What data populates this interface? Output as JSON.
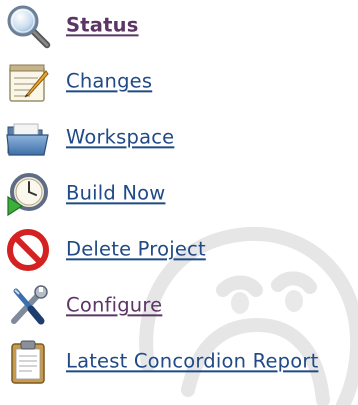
{
  "sidebar": {
    "tasks": [
      {
        "label": "Status",
        "icon": "search-icon",
        "state": "current"
      },
      {
        "label": "Changes",
        "icon": "notepad-icon",
        "state": "link"
      },
      {
        "label": "Workspace",
        "icon": "folder-icon",
        "state": "link"
      },
      {
        "label": "Build Now",
        "icon": "clock-play-icon",
        "state": "link"
      },
      {
        "label": "Delete Project",
        "icon": "no-entry-icon",
        "state": "link"
      },
      {
        "label": "Configure",
        "icon": "wrench-screwdriver-icon",
        "state": "visited"
      },
      {
        "label": "Latest Concordion Report",
        "icon": "clipboard-icon",
        "state": "link"
      }
    ]
  },
  "colors": {
    "link": "#204a87",
    "visited_link": "#5c3566",
    "background": "#ffffff",
    "watermark": "#d9d9d9"
  }
}
